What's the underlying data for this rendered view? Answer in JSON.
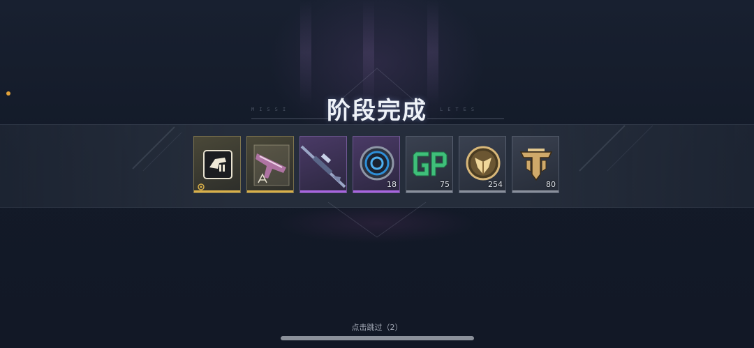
{
  "title": "阶段完成",
  "subtitle_left": "MISSI",
  "subtitle_right": "LETES",
  "rewards": [
    {
      "icon": "weapon-blueprint-icon",
      "rarity": "gold",
      "count": ""
    },
    {
      "icon": "weapon-skin-blueprint-icon",
      "rarity": "gold",
      "count": ""
    },
    {
      "icon": "sniper-rifle-icon",
      "rarity": "purple",
      "count": ""
    },
    {
      "icon": "blue-token-icon",
      "rarity": "purple",
      "count": "18"
    },
    {
      "icon": "gp-currency-icon",
      "rarity": "grey",
      "count": "75"
    },
    {
      "icon": "gold-medal-icon",
      "rarity": "grey",
      "count": "254"
    },
    {
      "icon": "battle-pass-emblem-icon",
      "rarity": "grey",
      "count": "80"
    }
  ],
  "colors": {
    "gold_rarity": "#d9b04a",
    "purple_rarity": "#a865e0",
    "grey_rarity": "#8a909c",
    "accent_dot": "#e2a23a"
  },
  "skip_label": "点击跳过（2）"
}
